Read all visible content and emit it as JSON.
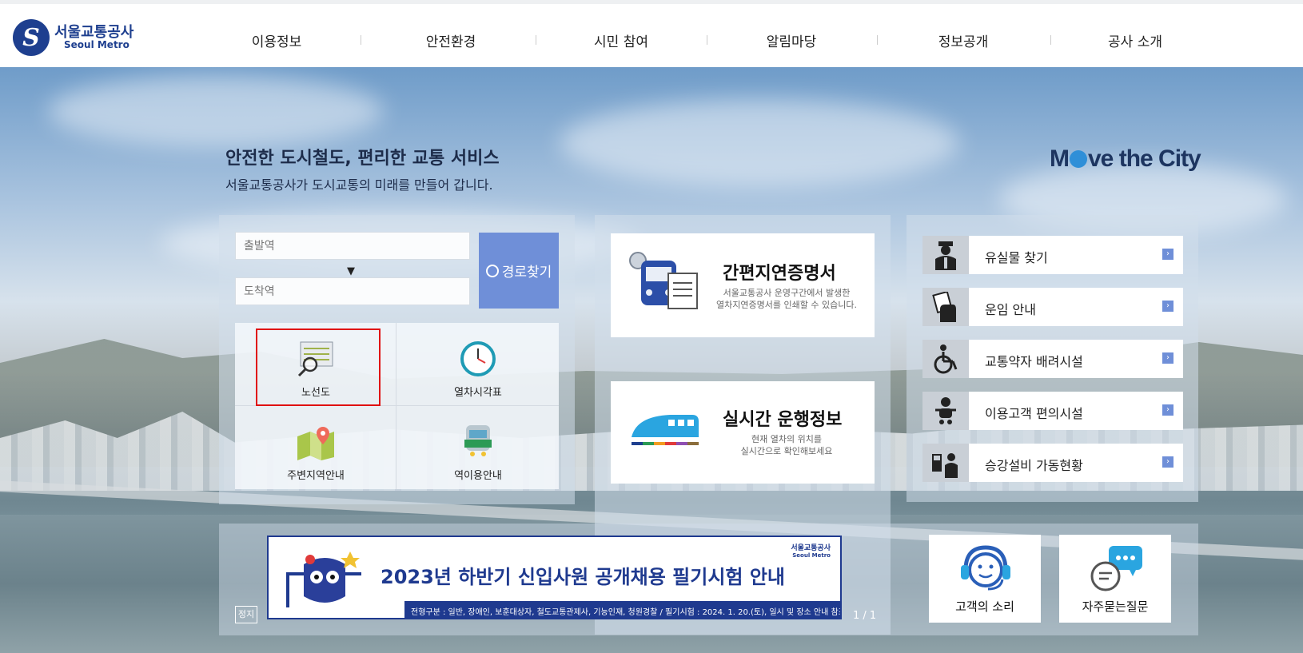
{
  "header": {
    "logo_ko": "서울교통공사",
    "logo_en": "Seoul Metro",
    "nav": [
      "이용정보",
      "안전환경",
      "시민 참여",
      "알림마당",
      "정보공개",
      "공사 소개"
    ]
  },
  "hero": {
    "headline": "안전한 도시철도, 편리한 교통 서비스",
    "subline": "서울교통공사가 도시교통의 미래를 만들어 갑니다.",
    "slogan_pre": "M",
    "slogan_post": "ve the City"
  },
  "route": {
    "from_placeholder": "출발역",
    "to_placeholder": "도착역",
    "search_label": "경로찾기"
  },
  "quick": [
    {
      "label": "노선도",
      "icon": "route-map-icon"
    },
    {
      "label": "열차시각표",
      "icon": "clock-icon"
    },
    {
      "label": "주변지역안내",
      "icon": "map-pin-icon"
    },
    {
      "label": "역이용안내",
      "icon": "train-icon"
    }
  ],
  "cards": [
    {
      "title": "간편지연증명서",
      "desc1": "서울교통공사 운영구간에서 발생한",
      "desc2": "열차지연증명서를 인쇄할 수 있습니다.",
      "icon": "train-document-icon"
    },
    {
      "title": "실시간 운행정보",
      "desc1": "현재 열차의 위치를",
      "desc2": "실시간으로 확인해보세요",
      "icon": "bullet-train-icon"
    }
  ],
  "services": [
    {
      "label": "유실물 찾기",
      "icon": "officer-icon"
    },
    {
      "label": "운임 안내",
      "icon": "ticket-hand-icon"
    },
    {
      "label": "교통약자 배려시설",
      "icon": "wheelchair-icon"
    },
    {
      "label": "이용고객 편의시설",
      "icon": "baby-icon"
    },
    {
      "label": "승강설비 가동현황",
      "icon": "escalator-icon"
    }
  ],
  "banner": {
    "title": "2023년 하반기 신입사원 공개채용 필기시험 안내",
    "strip": "전형구분 : 일반, 장애인, 보훈대상자, 철도교통관제사, 기능인재, 청원경찰 / 필기시험 : 2024. 1. 20.(토), 일시 및 장소 안내 참조",
    "logo_ko": "서울교통공사",
    "logo_en": "Seoul Metro",
    "stop_label": "정지",
    "pager": "1 / 1"
  },
  "bottom": [
    {
      "label": "고객의 소리",
      "icon": "headset-icon"
    },
    {
      "label": "자주묻는질문",
      "icon": "chat-bubbles-icon"
    }
  ],
  "colors": {
    "brand": "#1e3f8f",
    "accent": "#6f8fd8",
    "highlight": "#e01010"
  }
}
